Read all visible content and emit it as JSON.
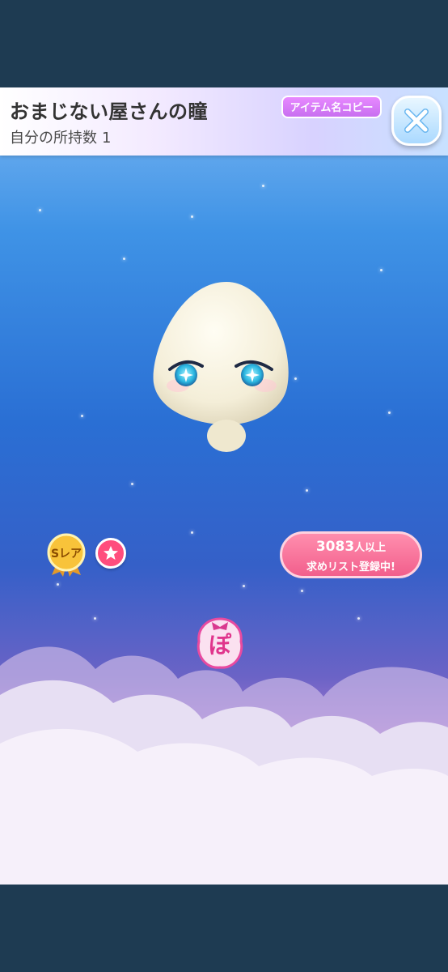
{
  "header": {
    "title": "おまじない屋さんの瞳",
    "owned_label": "自分の所持数",
    "owned_count": "1",
    "copy_button_label": "アイテム名コピー",
    "close_icon": "close-icon"
  },
  "item": {
    "rarity_label": "Sレア",
    "favorite_icon": "star-icon",
    "want_count": "3083",
    "want_suffix": "人以上",
    "want_text": "求めリスト登録中!",
    "logo_text": "ぽ"
  },
  "colors": {
    "frame": "#1e3b52",
    "sky_top": "#7ab6f2",
    "sky_mid": "#2a6fd4",
    "badge_pink": "#f25f8c",
    "copy_purple": "#c86ff0"
  }
}
